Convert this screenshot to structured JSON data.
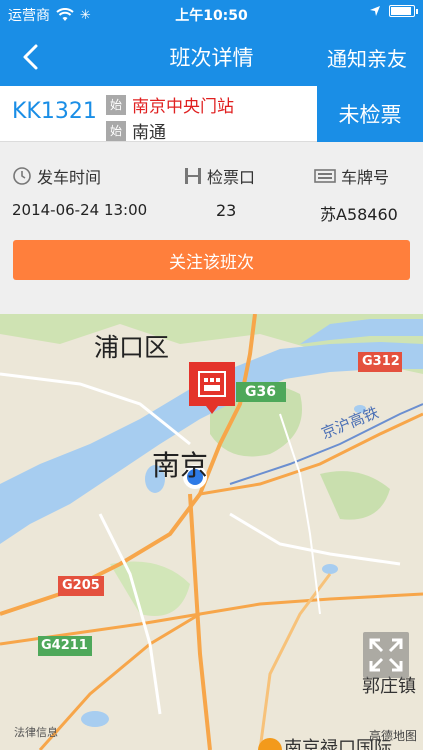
{
  "status_bar": {
    "carrier": "运营商",
    "time": "上午10:50"
  },
  "nav": {
    "title": "班次详情",
    "action": "通知亲友",
    "back_icon": "chevron-left-icon"
  },
  "route": {
    "train_no": "KK1321",
    "from_tag": "始",
    "from_station": "南京中央门站",
    "to_tag": "始",
    "to_station": "南通",
    "check_status": "未检票"
  },
  "info": {
    "departure": {
      "label": "发车时间",
      "value": "2014-06-24 13:00",
      "icon": "clock-icon"
    },
    "gate": {
      "label": "检票口",
      "value": "23",
      "icon": "gate-icon"
    },
    "plate": {
      "label": "车牌号",
      "value": "苏A58460",
      "icon": "plate-icon"
    }
  },
  "follow_button": "关注该班次",
  "map": {
    "labels": {
      "pukou": "浦口区",
      "nanjing": "南京",
      "g312": "G312",
      "g36": "G36",
      "g205": "G205",
      "g4211": "G4211",
      "railway": "京沪高铁",
      "guozhuang": "郭庄镇",
      "bottom_place": "南京禄口国际"
    },
    "legal": "法律信息",
    "brand": "高德地图"
  },
  "colors": {
    "primary": "#1a8ee6",
    "accent": "#ff7f3c",
    "station_red": "#e02020"
  }
}
